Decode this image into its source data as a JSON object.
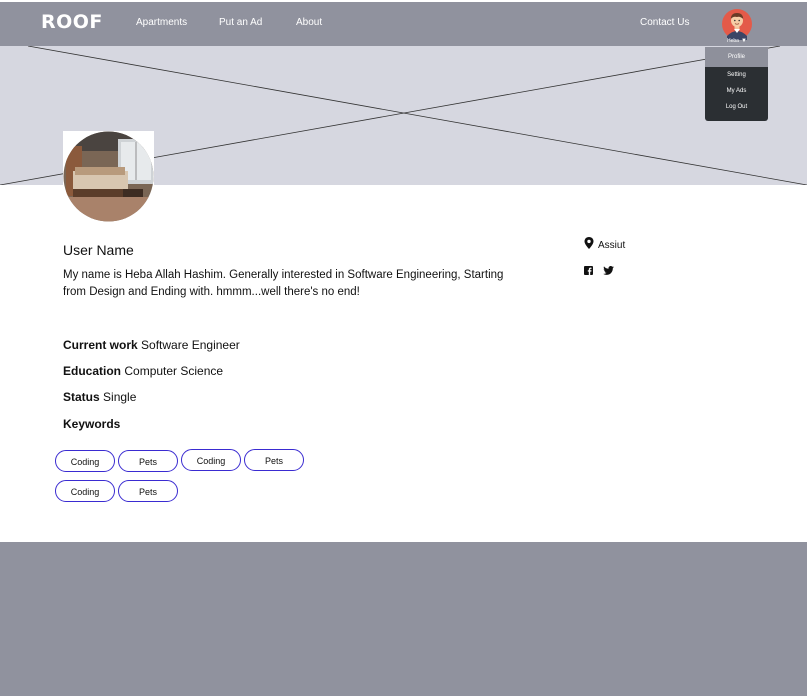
{
  "nav": {
    "logo": "ROOF",
    "links": [
      "Apartments",
      "Put an Ad",
      "About"
    ],
    "contact": "Contact Us",
    "user_caption": "Heba"
  },
  "dropdown": {
    "items": [
      "Profile",
      "Setting",
      "My Ads",
      "Log Out"
    ],
    "active": "Profile"
  },
  "profile": {
    "name": "User Name",
    "bio": "My name is Heba Allah Hashim. Generally interested in Software Engineering, Starting from Design and Ending with. hmmm...well there's no end!",
    "location": "Assiut",
    "details": [
      {
        "label": "Current work",
        "value": "Software Engineer"
      },
      {
        "label": "Education",
        "value": "Computer Science"
      },
      {
        "label": "Status",
        "value": "Single"
      }
    ],
    "keywords_label": "Keywords",
    "keywords": [
      "Coding",
      "Pets",
      "Coding",
      "Pets",
      "Coding",
      "Pets"
    ]
  },
  "icons": {
    "location": "map-pin-icon",
    "social": [
      "facebook-icon",
      "twitter-icon"
    ]
  },
  "colors": {
    "navbar": "#90929e",
    "cover": "#d6d7e0",
    "chip_border": "#3a2bd1",
    "dropdown": "#2b2f33",
    "footer": "#90929e"
  }
}
